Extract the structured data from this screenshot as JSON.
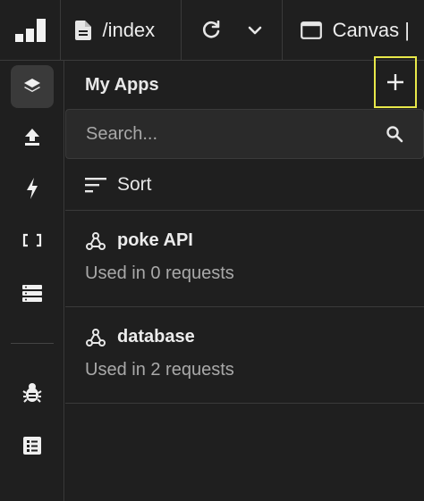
{
  "topbar": {
    "logo_icon": "app-logo-icon",
    "path_label": "/index",
    "canvas_label": "Canvas |"
  },
  "rail": {
    "items": [
      {
        "icon": "layers-icon",
        "active": true
      },
      {
        "icon": "upload-icon",
        "active": false
      },
      {
        "icon": "lightning-icon",
        "active": false
      },
      {
        "icon": "brackets-icon",
        "active": false
      },
      {
        "icon": "database-icon",
        "active": false
      },
      {
        "icon": "bug-icon",
        "active": false
      },
      {
        "icon": "list-icon",
        "active": false
      }
    ]
  },
  "panel": {
    "title": "My Apps",
    "search_placeholder": "Search...",
    "sort_label": "Sort",
    "apps": [
      {
        "name": "poke API",
        "usage": "Used in 0 requests"
      },
      {
        "name": "database",
        "usage": "Used in 2 requests"
      }
    ]
  },
  "colors": {
    "background": "#1f1f1f",
    "border": "#3a3a3a",
    "highlight": "#e8e84a",
    "text": "#e6e6e6",
    "muted": "#a9a9a9"
  }
}
